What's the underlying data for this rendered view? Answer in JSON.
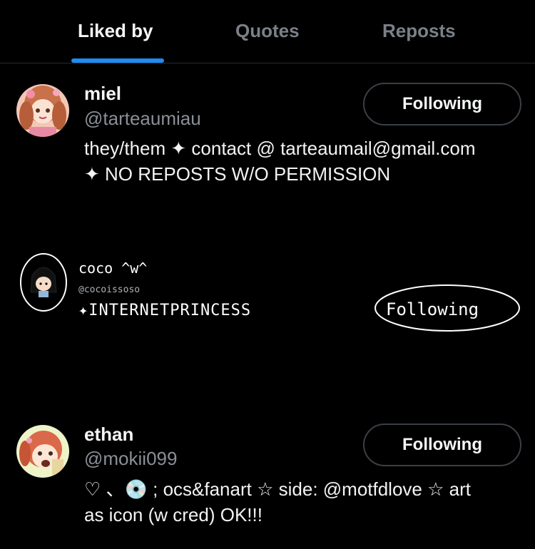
{
  "tabs": [
    {
      "label": "Liked by",
      "active": true
    },
    {
      "label": "Quotes",
      "active": false
    },
    {
      "label": "Reposts",
      "active": false
    }
  ],
  "accent_color": "#1d8cf2",
  "users": [
    {
      "name": "miel",
      "handle": "@tarteaumiau",
      "button_label": "Following",
      "bio_line1": "they/them ✦ contact @ tarteaumail@gmail.com",
      "bio_line2": "✦ NO REPOSTS W/O PERMISSION"
    },
    {
      "name": "coco ^w^",
      "handle": "@cocoissoso",
      "button_label": "Following",
      "bio": "✦INTERNETPRINCESS"
    },
    {
      "name": "ethan",
      "handle": "@mokii099",
      "button_label": "Following",
      "bio_line1": "♡ 、💿 ; ocs&fanart ☆ side: @motfdlove ☆ art",
      "bio_line2": "as icon (w cred) OK!!!"
    }
  ]
}
